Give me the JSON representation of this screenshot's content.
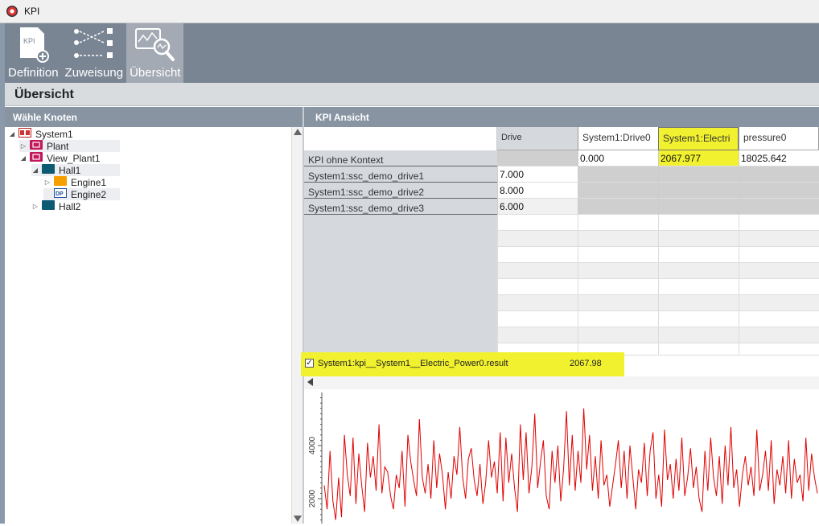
{
  "window": {
    "title": "KPI"
  },
  "toolbar": {
    "items": [
      {
        "label": "Definition",
        "icon": "kpi-document-add-icon"
      },
      {
        "label": "Zuweisung",
        "icon": "assignment-arrows-icon"
      },
      {
        "label": "Übersicht",
        "icon": "chart-magnifier-icon",
        "active": true
      }
    ]
  },
  "section": {
    "title": "Übersicht"
  },
  "tree": {
    "header": "Wähle Knoten",
    "nodes": [
      {
        "label": "System1",
        "icon": "system-icon",
        "expanded": true
      },
      {
        "label": "Plant",
        "icon": "plant-icon",
        "expanded": false
      },
      {
        "label": "View_Plant1",
        "icon": "plant-icon",
        "expanded": true
      },
      {
        "label": "Hall1",
        "icon": "hall-icon",
        "expanded": true
      },
      {
        "label": "Engine1",
        "icon": "engine-icon",
        "expanded": false
      },
      {
        "label": "Engine2",
        "icon": "datapoint-icon"
      },
      {
        "label": "Hall2",
        "icon": "hall-icon",
        "expanded": false
      }
    ]
  },
  "kpi": {
    "header": "KPI Ansicht",
    "columns": [
      "Drive",
      "System1:Drive0",
      "System1:Electri",
      "pressure0"
    ],
    "rows": [
      {
        "label": "KPI ohne Kontext",
        "cells": [
          "",
          "0.000",
          "2067.977",
          "18025.642"
        ]
      },
      {
        "label": "System1:ssc_demo_drive1",
        "cells": [
          "7.000",
          "",
          "",
          ""
        ]
      },
      {
        "label": "System1:ssc_demo_drive2",
        "cells": [
          "8.000",
          "",
          "",
          ""
        ]
      },
      {
        "label": "System1:ssc_demo_drive3",
        "cells": [
          "6.000",
          "",
          "",
          ""
        ]
      }
    ]
  },
  "legend": {
    "checked": true,
    "check_mark": "✓",
    "series_name": "System1:kpi__System1__Electric_Power0.result",
    "value": "2067.98"
  },
  "chart_data": {
    "type": "line",
    "ylabel": "",
    "yticks": [
      "2000",
      "4000"
    ],
    "ylim": [
      1000,
      6000
    ],
    "series": [
      {
        "color": "#e00000",
        "values": [
          2500,
          1600,
          3800,
          1900,
          1200,
          2800,
          1300,
          4400,
          2900,
          2100,
          4300,
          1800,
          3700,
          2500,
          1500,
          4100,
          2800,
          3600,
          2300,
          4800,
          2200,
          3200,
          3000,
          2100,
          1600,
          2900,
          2400,
          3800,
          1700,
          4400,
          3400,
          2700,
          2100,
          5000,
          2800,
          2200,
          3300,
          2000,
          4200,
          2400,
          3700,
          2900,
          1600,
          3000,
          2000,
          3600,
          2900,
          4700,
          2800,
          2000,
          3500,
          3900,
          2700,
          2100,
          3300,
          1800,
          2600,
          4200,
          2800,
          3400,
          2200,
          4500,
          1900,
          4300,
          2600,
          3700,
          2400,
          1500,
          4800,
          2700,
          4500,
          2200,
          3200,
          5200,
          2400,
          3400,
          4200,
          2100,
          1600,
          3800,
          2600,
          4000,
          1900,
          3100,
          5300,
          2500,
          4400,
          2300,
          3800,
          2600,
          5400,
          3100,
          4400,
          2300,
          3600,
          2000,
          4200,
          2500,
          2900,
          1700,
          2500,
          3300,
          4200,
          2400,
          3800,
          2000,
          4000,
          2800,
          1600,
          3100,
          2600,
          4100,
          2100,
          3800,
          4500,
          2000,
          2900,
          1700,
          4600,
          2700,
          3300,
          2000,
          3500,
          2300,
          4300,
          2100,
          2800,
          3900,
          2400,
          3200,
          2000,
          1500,
          3800,
          2300,
          4300,
          2800,
          2100,
          3600,
          1800,
          4000,
          2500,
          4700,
          2400,
          3100,
          1700,
          2900,
          3600,
          2500,
          3200,
          2100,
          4600,
          2300,
          2900,
          3800,
          2300,
          4200,
          1800,
          3100,
          2500,
          3600,
          2200,
          4200,
          2000,
          3500,
          2600,
          2900,
          1900,
          4300,
          2300,
          3700,
          2800,
          2200
        ]
      }
    ]
  }
}
